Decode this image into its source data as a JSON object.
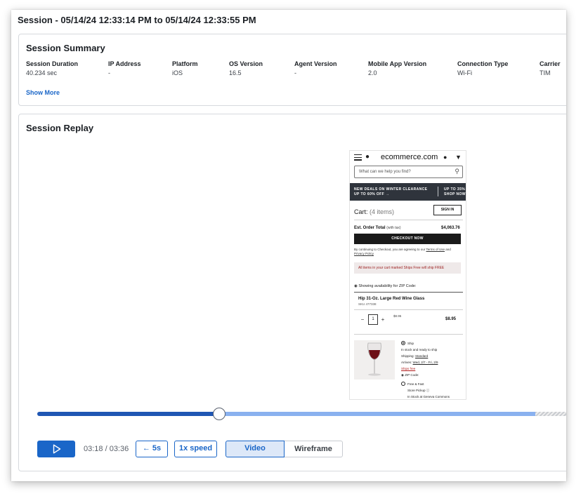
{
  "session": {
    "title": "Session - 05/14/24 12:33:14 PM to 05/14/24 12:33:55 PM"
  },
  "summary": {
    "heading": "Session Summary",
    "fields": [
      {
        "label": "Session Duration",
        "value": "40.234 sec"
      },
      {
        "label": "IP Address",
        "value": "-"
      },
      {
        "label": "Platform",
        "value": "iOS"
      },
      {
        "label": "OS Version",
        "value": "16.5"
      },
      {
        "label": "Agent Version",
        "value": "-"
      },
      {
        "label": "Mobile App Version",
        "value": "2.0"
      },
      {
        "label": "Connection Type",
        "value": "Wi-Fi"
      },
      {
        "label": "Carrier",
        "value": "TIM"
      }
    ],
    "show_more": "Show More"
  },
  "replay": {
    "heading": "Session Replay",
    "phone": {
      "brand": "ecommerce.com",
      "search_placeholder": "What can we help you find?",
      "banner_left_line1": "NEW DEALS ON WINTER CLEARANCE",
      "banner_left_line2": "UP TO 60% OFF →",
      "banner_right_line1": "UP TO 35%",
      "banner_right_line2": "SHOP NOW",
      "cart_label": "Cart:",
      "cart_count": "(4 items)",
      "sign_in": "SIGN IN",
      "est_label": "Est. Order Total",
      "est_note": "(with tax)",
      "est_value": "$4,063.76",
      "checkout": "CHECKOUT NOW",
      "terms_prefix": "By continuing to Checkout, you are agreeing to our",
      "terms_link": "Terms of Use",
      "terms_and": "and",
      "privacy_link": "Privacy Policy",
      "notice": "All items in your cart marked Ships Free will ship FREE",
      "availability": "Showing availability for ZIP Code:",
      "product_name": "Hip 31-Oz. Large Red Wine Glass",
      "sku": "SKU 477338",
      "qty": "1",
      "unit_price": "$8.95",
      "price": "$8.95",
      "ship": "Ship",
      "ship_stock": "In stock and ready to ship",
      "shipping_label": "Shipping:",
      "shipping_value": "Standard",
      "arrives_label": "Arrives:",
      "arrives_value": "Wed, 2/7 - Fri, 2/9",
      "ships_free": "Ships free",
      "zip_label": "ZIP Code:",
      "pickup": "Free & Fast",
      "pickup2": "Store Pickup",
      "instore": "In Stock at Geneva Commons"
    },
    "timeline": {
      "played_fraction": 0.344,
      "buffered_fraction": 0.94
    },
    "controls": {
      "time": "03:18 / 03:36",
      "back": "← 5s",
      "speed": "1x speed",
      "video": "Video",
      "wireframe": "Wireframe"
    }
  },
  "colors": {
    "accent": "#1a66c8",
    "timeline_played": "#1f56b3",
    "timeline_buffered": "#8ab1ef"
  }
}
